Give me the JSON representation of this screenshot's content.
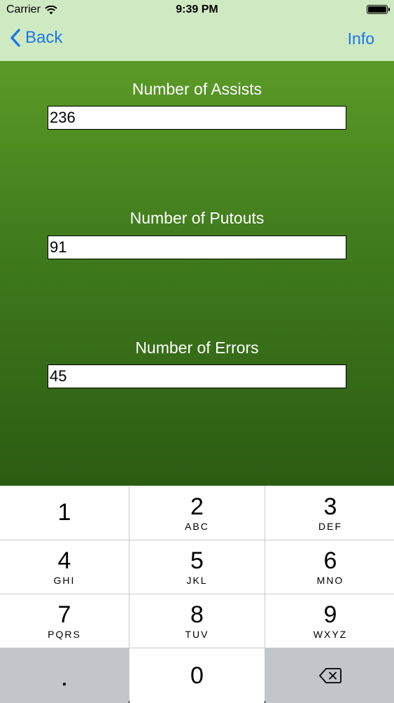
{
  "status": {
    "carrier": "Carrier",
    "time": "9:39 PM"
  },
  "nav": {
    "back_label": "Back",
    "info_label": "Info",
    "accent": "#1a78e6"
  },
  "fields": [
    {
      "label": "Number of Assists",
      "value": "236"
    },
    {
      "label": "Number of Putouts",
      "value": "91"
    },
    {
      "label": "Number of Errors",
      "value": "45"
    }
  ],
  "keypad": {
    "keys": [
      {
        "digit": "1",
        "letters": ""
      },
      {
        "digit": "2",
        "letters": "ABC"
      },
      {
        "digit": "3",
        "letters": "DEF"
      },
      {
        "digit": "4",
        "letters": "GHI"
      },
      {
        "digit": "5",
        "letters": "JKL"
      },
      {
        "digit": "6",
        "letters": "MNO"
      },
      {
        "digit": "7",
        "letters": "PQRS"
      },
      {
        "digit": "8",
        "letters": "TUV"
      },
      {
        "digit": "9",
        "letters": "WXYZ"
      }
    ],
    "decimal": ".",
    "zero": "0",
    "delete_icon": "backspace-icon"
  },
  "colors": {
    "nav_bg": "#cfe9c2",
    "gradient_top": "#5b9a27",
    "gradient_bottom": "#2c5c12"
  }
}
